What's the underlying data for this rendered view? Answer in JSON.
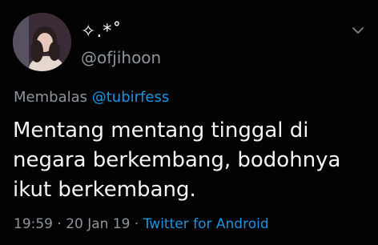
{
  "author": {
    "display_name": "✧.*˚",
    "handle": "@ofjihoon"
  },
  "reply": {
    "prefix": "Membalas",
    "to_handle": "@tubirfess"
  },
  "tweet": {
    "text": "Mentang mentang tinggal di negara berkembang, bodohnya ikut berkembang."
  },
  "meta": {
    "time": "19:59",
    "sep1": " · ",
    "date": "20 Jan 19",
    "sep2": " · ",
    "source": "Twitter for Android"
  },
  "icons": {
    "more_menu": "chevron-down-icon"
  },
  "colors": {
    "background": "#020202",
    "text": "#f4f4f4",
    "muted": "#8e959c",
    "link": "#1b95e0"
  }
}
